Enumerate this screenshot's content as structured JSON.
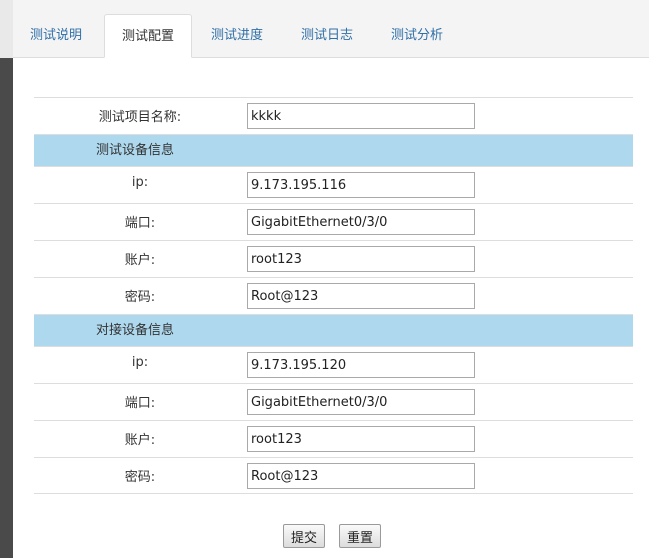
{
  "tabs": [
    {
      "label": "测试说明",
      "active": false
    },
    {
      "label": "测试配置",
      "active": true
    },
    {
      "label": "测试进度",
      "active": false
    },
    {
      "label": "测试日志",
      "active": false
    },
    {
      "label": "测试分析",
      "active": false
    }
  ],
  "form": {
    "project_name": {
      "label": "测试项目名称:",
      "value": "kkkk"
    },
    "test_device": {
      "section_title": "测试设备信息",
      "ip": {
        "label": "ip:",
        "value": "9.173.195.116"
      },
      "port": {
        "label": "端口:",
        "value": "GigabitEthernet0/3/0"
      },
      "account": {
        "label": "账户:",
        "value": "root123"
      },
      "password": {
        "label": "密码:",
        "value": "Root@123"
      }
    },
    "peer_device": {
      "section_title": "对接设备信息",
      "ip": {
        "label": "ip:",
        "value": "9.173.195.120"
      },
      "port": {
        "label": "端口:",
        "value": "GigabitEthernet0/3/0"
      },
      "account": {
        "label": "账户:",
        "value": "root123"
      },
      "password": {
        "label": "密码:",
        "value": "Root@123"
      }
    }
  },
  "buttons": {
    "submit": "提交",
    "reset": "重置"
  },
  "colors": {
    "tab_link": "#2f6fa8",
    "section_bg": "#aed8ee",
    "sidebar_dark": "#4a4a4a"
  }
}
